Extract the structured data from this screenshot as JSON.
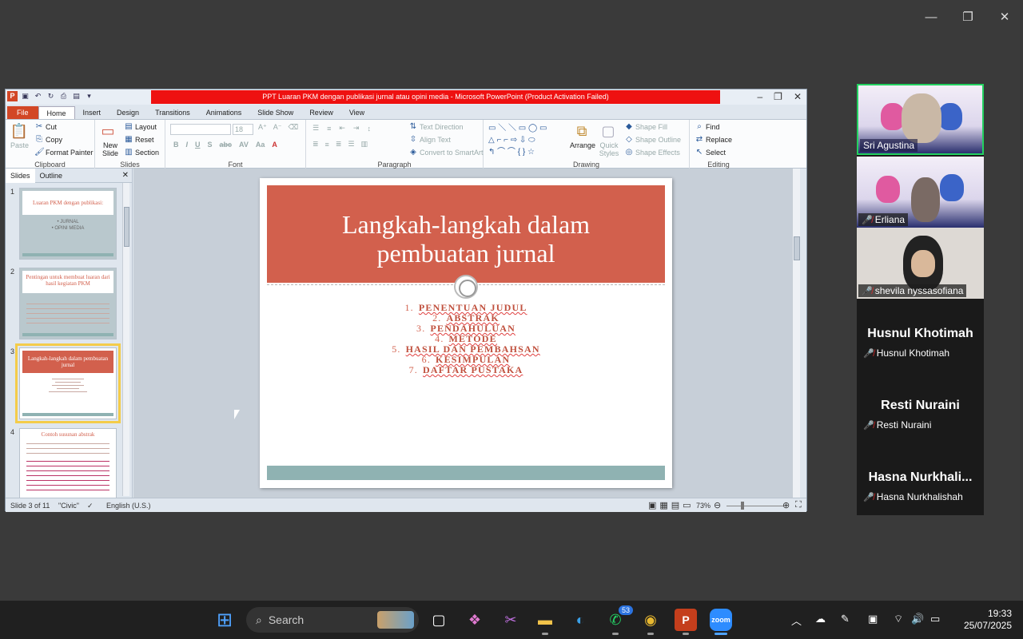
{
  "zoom_window": {
    "minimize": "—",
    "restore": "❐",
    "close": "✕"
  },
  "ppt": {
    "title": "PPT Luaran PKM dengan publikasi jurnal atau opini media - Microsoft PowerPoint (Product Activation Failed)",
    "tabs": [
      "File",
      "Home",
      "Insert",
      "Design",
      "Transitions",
      "Animations",
      "Slide Show",
      "Review",
      "View"
    ],
    "active_tab": "Home",
    "clipboard": {
      "paste": "Paste",
      "cut": "Cut",
      "copy": "Copy",
      "format_painter": "Format Painter",
      "label": "Clipboard"
    },
    "slides_group": {
      "new_slide": "New Slide",
      "layout": "Layout",
      "reset": "Reset",
      "section": "Section",
      "label": "Slides"
    },
    "font_group": {
      "size": "18",
      "label": "Font"
    },
    "paragraph_group": {
      "text_direction": "Text Direction",
      "align_text": "Align Text",
      "convert": "Convert to SmartArt",
      "label": "Paragraph"
    },
    "drawing_group": {
      "arrange": "Arrange",
      "quick_styles": "Quick Styles",
      "shape_fill": "Shape Fill",
      "shape_outline": "Shape Outline",
      "shape_effects": "Shape Effects",
      "label": "Drawing"
    },
    "editing_group": {
      "find": "Find",
      "replace": "Replace",
      "select": "Select",
      "label": "Editing"
    },
    "pane_tabs": {
      "slides": "Slides",
      "outline": "Outline"
    },
    "thumbs": [
      {
        "num": "1",
        "title": "Luaran PKM dengan publikasi:",
        "sub1": "• JURNAL",
        "sub2": "• OPINI MEDIA"
      },
      {
        "num": "2",
        "title": "Pentingan untuk membuat luaran dari hasil kegiatan PKM"
      },
      {
        "num": "3",
        "title": "Langkah-langkah dalam pembuatan jurnal"
      },
      {
        "num": "4",
        "title": "Contoh susunan abstrak"
      }
    ],
    "slide": {
      "title_line1": "Langkah-langkah dalam",
      "title_line2": "pembuatan jurnal",
      "items": [
        {
          "n": "1.",
          "t": "PENENTUAN JUDUL"
        },
        {
          "n": "2.",
          "t": "ABSTRAK"
        },
        {
          "n": "3.",
          "t": "PENDAHULUAN"
        },
        {
          "n": "4.",
          "t": "METODE"
        },
        {
          "n": "5.",
          "t": "HASIL DAN PEMBAHSAN"
        },
        {
          "n": "6.",
          "t": "KESIMPULAN"
        },
        {
          "n": "7.",
          "t": "DAFTAR PUSTAKA"
        }
      ]
    },
    "status": {
      "slide": "Slide 3 of 11",
      "theme": "\"Civic\"",
      "lang": "English (U.S.)",
      "zoom": "73%"
    }
  },
  "participants": [
    {
      "name": "Sri Agustina",
      "muted": false
    },
    {
      "name": "Erliana",
      "muted": true
    },
    {
      "name": "shevila nyssasofiana",
      "muted": true
    },
    {
      "name": "Husnul Khotimah",
      "big": "Husnul Khotimah",
      "muted": true
    },
    {
      "name": "Resti Nuraini",
      "big": "Resti Nuraini",
      "muted": true
    },
    {
      "name": "Hasna Nurkhalishah",
      "big": "Hasna  Nurkhali...",
      "muted": true
    }
  ],
  "taskbar": {
    "search": "Search",
    "whatsapp_badge": "53",
    "time": "19:33",
    "date": "25/07/2025"
  }
}
